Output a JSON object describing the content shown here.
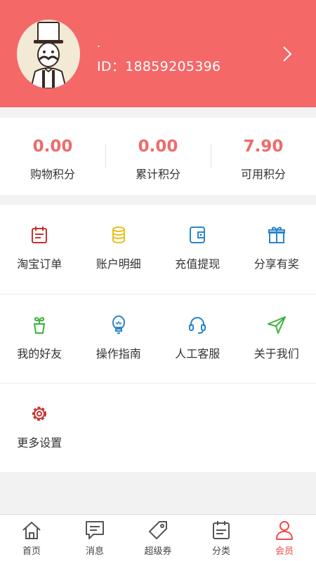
{
  "profile": {
    "nickname": ".",
    "id_text": "ID：18859205396"
  },
  "stats": [
    {
      "value": "0.00",
      "label": "购物积分"
    },
    {
      "value": "0.00",
      "label": "累计积分"
    },
    {
      "value": "7.90",
      "label": "可用积分"
    }
  ],
  "grid": [
    {
      "label": "淘宝订单",
      "icon": "calendar-icon",
      "color": "#c9302c"
    },
    {
      "label": "账户明细",
      "icon": "coins-icon",
      "color": "#e6c21e"
    },
    {
      "label": "充值提现",
      "icon": "wallet-icon",
      "color": "#2a86c9"
    },
    {
      "label": "分享有奖",
      "icon": "gift-icon",
      "color": "#2a86c9"
    },
    {
      "label": "我的好友",
      "icon": "plant-pot-icon",
      "color": "#3db33d"
    },
    {
      "label": "操作指南",
      "icon": "lightbulb-icon",
      "color": "#2a86c9"
    },
    {
      "label": "人工客服",
      "icon": "headset-icon",
      "color": "#2a86c9"
    },
    {
      "label": "关于我们",
      "icon": "send-icon",
      "color": "#3db33d"
    },
    {
      "label": "更多设置",
      "icon": "gear-icon",
      "color": "#c9302c"
    }
  ],
  "tabs": [
    {
      "label": "首页",
      "icon": "home-icon",
      "active": false
    },
    {
      "label": "消息",
      "icon": "message-icon",
      "active": false
    },
    {
      "label": "超级券",
      "icon": "coupon-tag-icon",
      "active": false
    },
    {
      "label": "分类",
      "icon": "category-calendar-icon",
      "active": false
    },
    {
      "label": "会员",
      "icon": "member-person-icon",
      "active": true
    }
  ],
  "colors": {
    "header_bg": "#f46868",
    "stat_value": "#ef6a6a",
    "tab_active": "#f04a4a",
    "tab_inactive": "#555555"
  }
}
